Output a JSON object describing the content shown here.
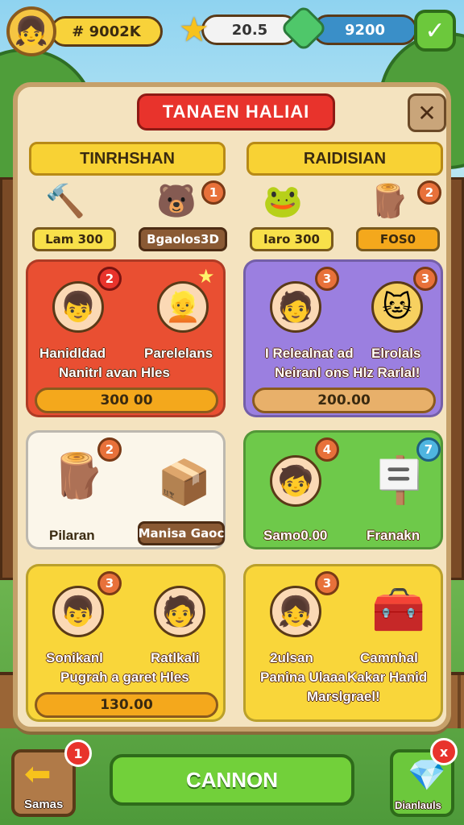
{
  "top_bar": {
    "coins": "# 9002K",
    "stars": "20.5",
    "gems": "9200",
    "avatar_icon": "girl-avatar",
    "confirm_icon": "check-icon"
  },
  "panel": {
    "title": "TANAEN HALIAI",
    "close_icon": "close-icon",
    "columns": [
      "TINRHSHAN",
      "RAIDISIAN"
    ]
  },
  "row1": {
    "left": {
      "tag1": "Lam 300",
      "tag2": "Bgaolos3D",
      "badge": "1",
      "item_icons": [
        "hammer-icon",
        "bear-icon"
      ]
    },
    "right": {
      "tag1": "Iaro 300",
      "tag2": "FOS0",
      "badge": "2",
      "item_icons": [
        "slime-icon",
        "wood-icon"
      ]
    }
  },
  "row2": {
    "left": {
      "badge": "2",
      "name1": "Hanidldad",
      "name2": "Parelelans",
      "desc": "Nanitrl avan Hles",
      "price": "300 00"
    },
    "right": {
      "badge1": "3",
      "badge2": "3",
      "name1": "I Relealnat ad",
      "name2": "Elrolals",
      "desc": "Neiranl ons Hlz Rarlal!",
      "price": "200.00"
    }
  },
  "row3": {
    "left": {
      "badge": "2",
      "label1": "Pilaran",
      "label2": "Manisa Gaoc"
    },
    "right": {
      "badge1": "4",
      "badge2": "7",
      "label1": "Samo0.00",
      "label2": "Franakn"
    }
  },
  "row4": {
    "left": {
      "badge": "3",
      "name1": "Sonikanl",
      "name2": "Ratlkali",
      "desc": "Pugrah a garet Hles",
      "price": "130.00"
    },
    "right": {
      "badge": "3",
      "name1": "2ulsan",
      "name2": "Camnhal",
      "desc1": "Panina Ulaaa",
      "desc2": "Kakar Hanid",
      "desc3": "Marslgrael!"
    }
  },
  "bottom": {
    "left_label": "Samas",
    "left_notif": "1",
    "cta": "CANNON",
    "right_label": "Dianlauls",
    "right_notif": "x"
  },
  "colors": {
    "red_card": "#e94f32",
    "purple_card": "#9b7fe0",
    "green_card": "#6ec94a",
    "yellow_card": "#f9d63a",
    "panel_bg": "#f4e3bf"
  }
}
